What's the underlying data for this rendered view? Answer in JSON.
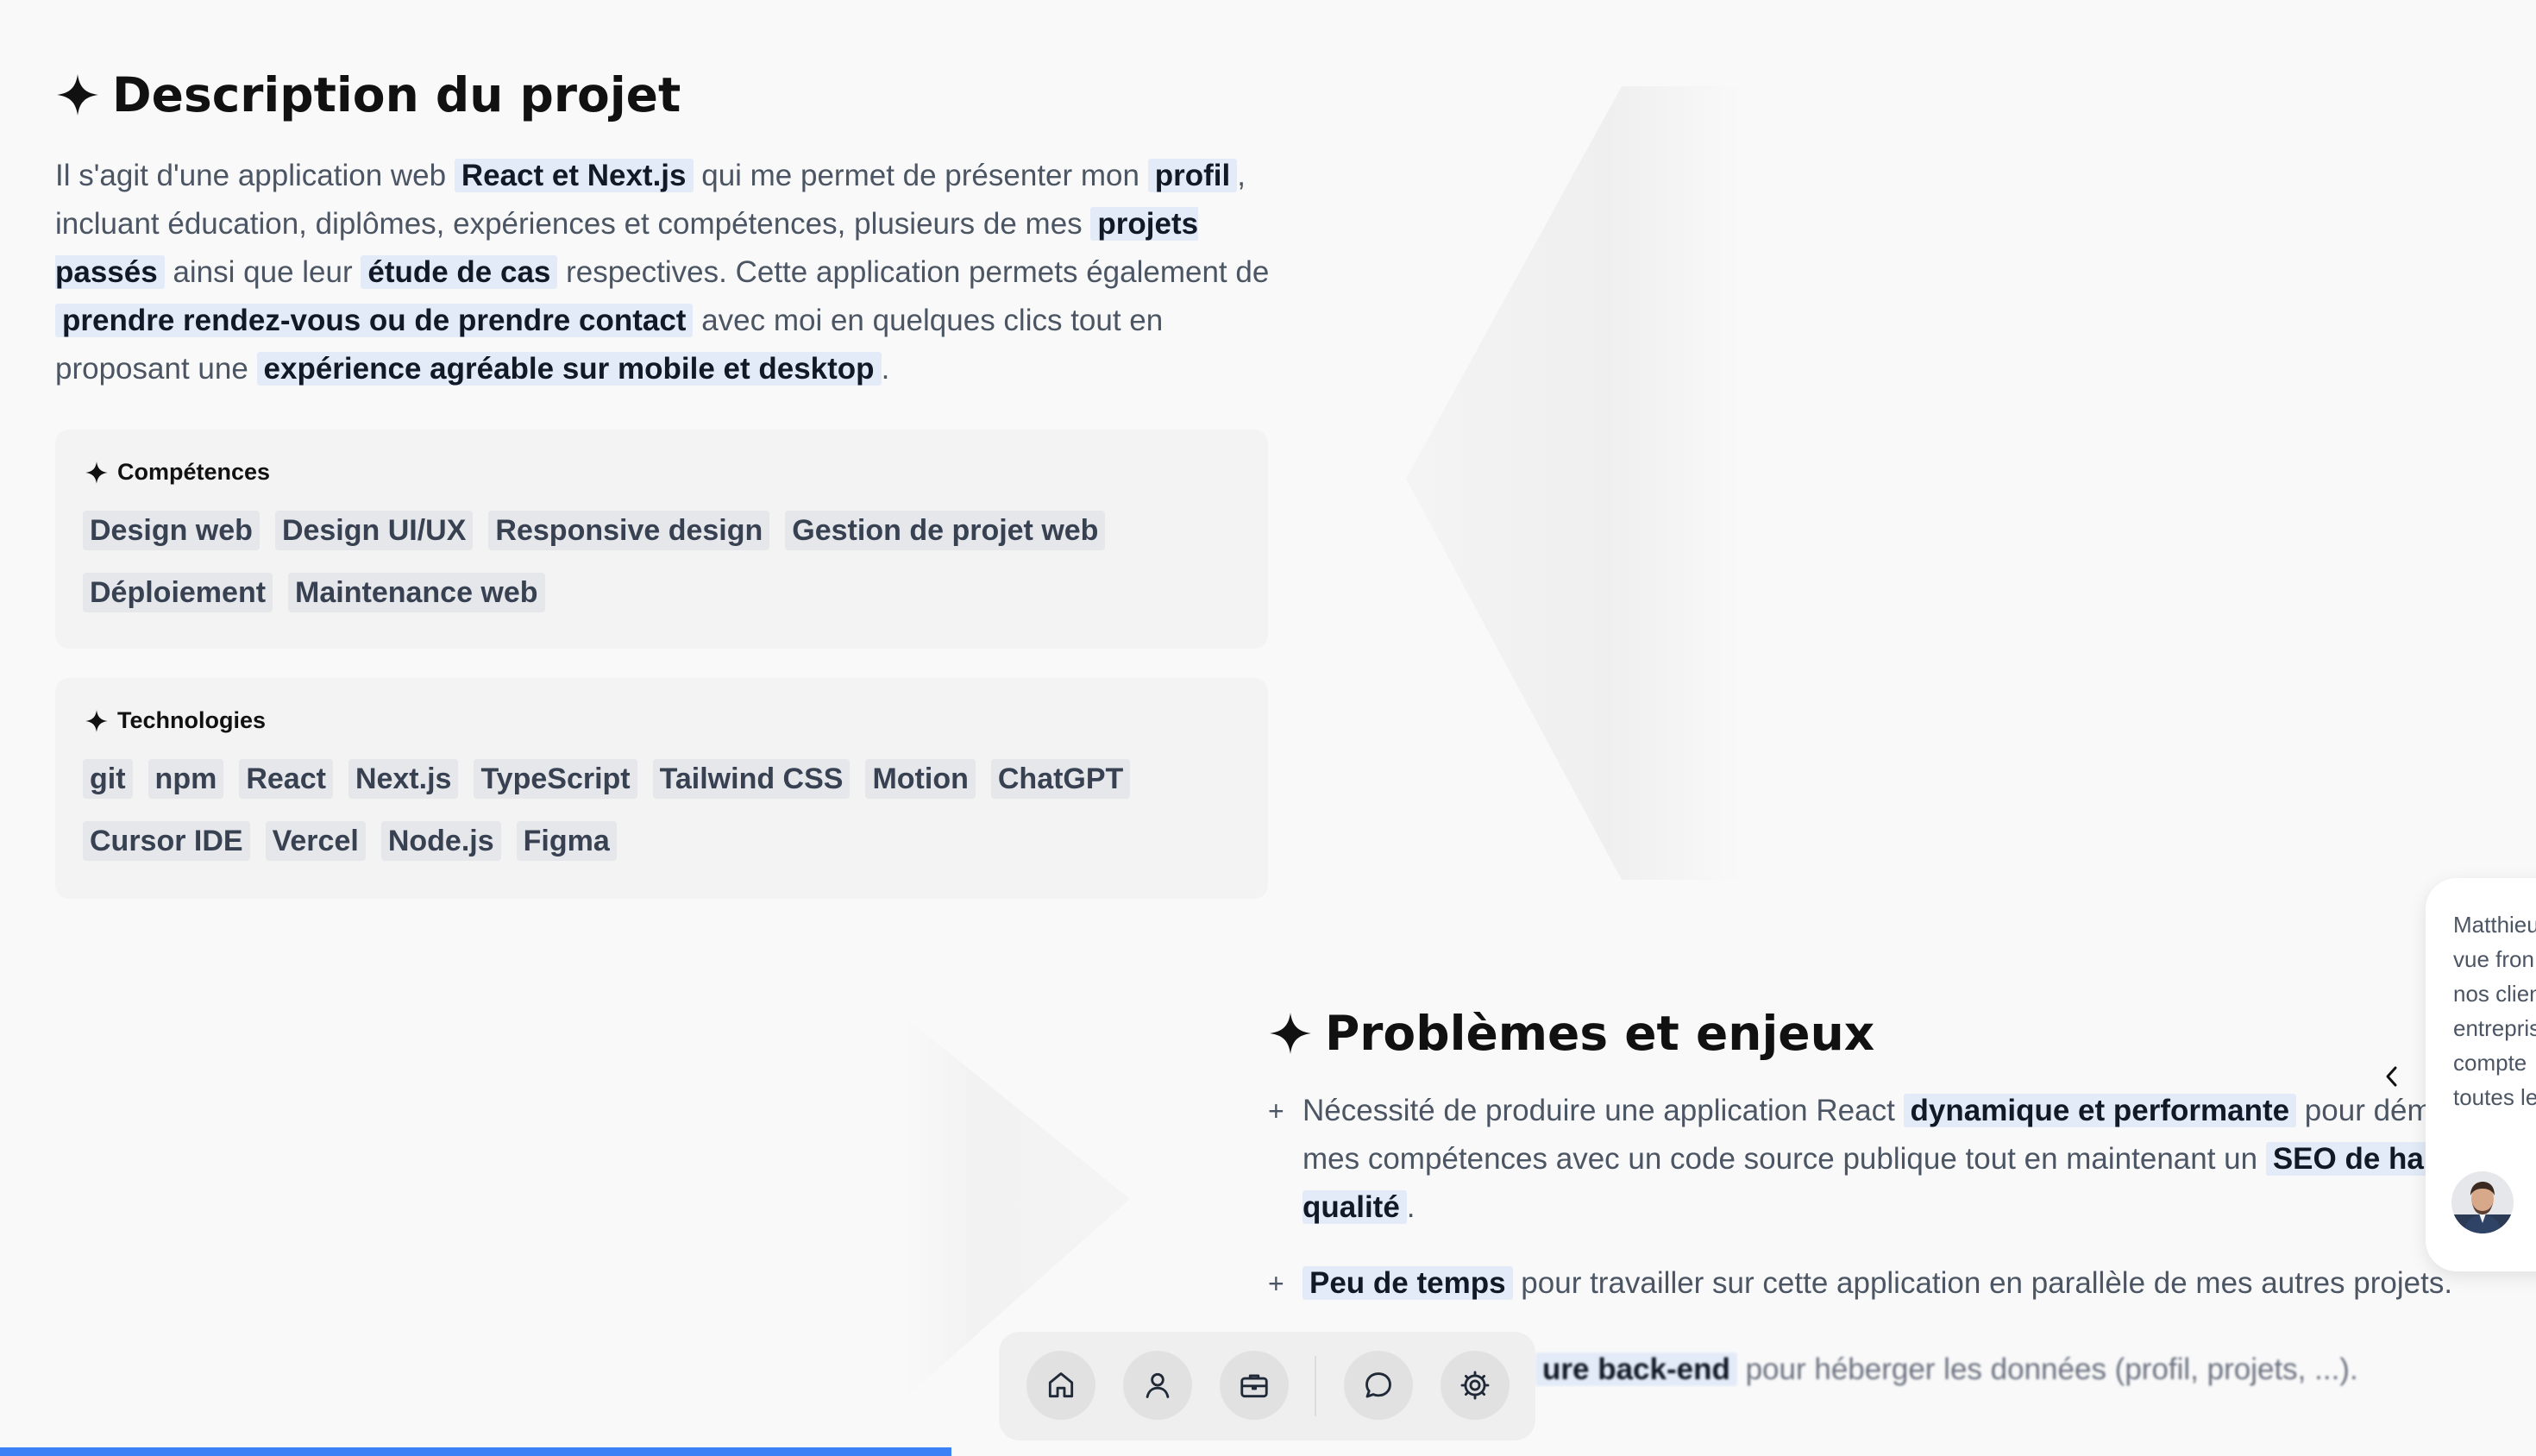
{
  "description": {
    "title": "Description du projet",
    "seg1": "Il s'agit d'une application web ",
    "hl1": "React et Next.js",
    "seg2": " qui me permet de présenter mon ",
    "hl2": "profil",
    "seg3": ", incluant éducation, diplômes, expériences et compétences, plusieurs de mes ",
    "hl3": "projets passés",
    "seg4": " ainsi que leur ",
    "hl4": "étude de cas",
    "seg5": " respectives. Cette application permets également de ",
    "hl5": "prendre rendez-vous ou de prendre contact",
    "seg6": " avec moi en quelques clics tout en proposant une ",
    "hl6": "expérience agréable sur mobile et desktop",
    "seg7": "."
  },
  "competences": {
    "title": "Compétences",
    "row1": [
      "Design web",
      "Design UI/UX",
      "Responsive design",
      "Gestion de projet web"
    ],
    "row2": [
      "Déploiement",
      "Maintenance web"
    ]
  },
  "technologies": {
    "title": "Technologies",
    "row1": [
      "git",
      "npm",
      "React",
      "Next.js",
      "TypeScript",
      "Tailwind CSS",
      "Motion",
      "ChatGPT"
    ],
    "row2": [
      "Cursor IDE",
      "Vercel",
      "Node.js",
      "Figma"
    ]
  },
  "problems": {
    "title": "Problèmes et enjeux",
    "p1_a": "Nécessité de produire une application React ",
    "p1_hl1": "dynamique et performante",
    "p1_b": " pour démon",
    "p1_c": "mes compétences avec un code source publique tout en maintenant un ",
    "p1_hl2": "SEO de haute",
    "p1_hl3": "qualité",
    "p1_d": ".",
    "p2_hl": "Peu de temps",
    "p2_a": " pour travailler sur cette application en parallèle de mes autres projets.",
    "p3_hl": "ure back-end",
    "p3_a": " pour héberger les données (profil, projets, ...)."
  },
  "testimonial": {
    "lines": [
      "Matthieu",
      "vue fron",
      "nos clien",
      "entrepris",
      "compte",
      "toutes le"
    ],
    "prev_icon": "chevron-left-icon"
  },
  "dock": {
    "items": [
      {
        "name": "home",
        "icon": "home-icon"
      },
      {
        "name": "profile",
        "icon": "user-icon"
      },
      {
        "name": "projects",
        "icon": "briefcase-icon"
      },
      {
        "name": "contact",
        "icon": "chat-icon"
      },
      {
        "name": "settings",
        "icon": "gear-icon"
      }
    ]
  },
  "progress": {
    "fraction": 0.375,
    "color": "#3b82f6"
  },
  "colors": {
    "highlight": "#e3ebf8",
    "chip": "#e6e7ea",
    "panel": "#f3f3f3",
    "accent": "#3b82f6"
  }
}
